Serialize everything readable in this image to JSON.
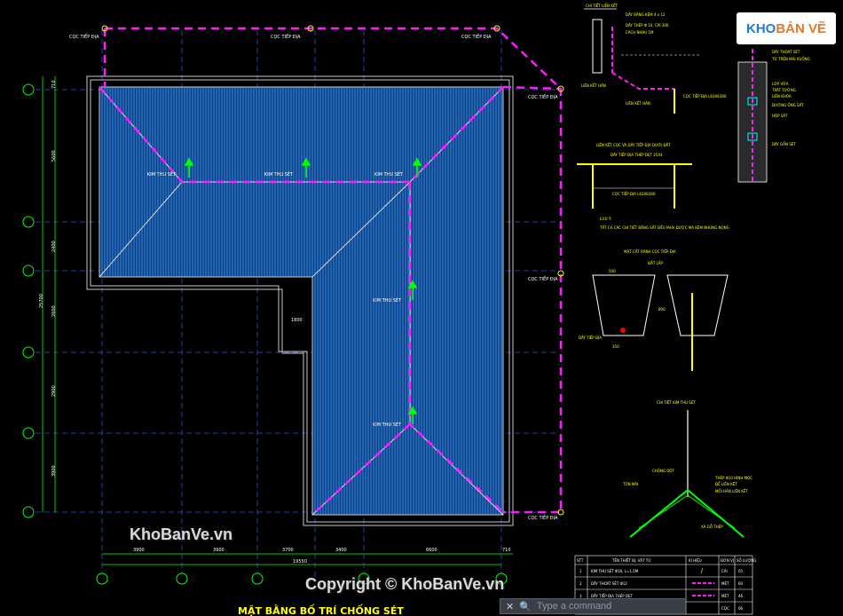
{
  "branding": {
    "logo_text_a": "KHO",
    "logo_text_b": "BẢN VẼ"
  },
  "watermarks": {
    "top": "KhoBanVe.vn",
    "bottom": "Copyright © KhoBanVe.vn"
  },
  "command_bar": {
    "placeholder": "Type a command",
    "close": "✕",
    "search": "🔍"
  },
  "plan": {
    "title": "MẶT BẰNG BỐ TRÍ CHỐNG SÉT",
    "rod_labels": [
      "KIM THU SÉT",
      "KIM THU SÉT",
      "KIM THU SÉT",
      "KIM THU SÉT",
      "KIM THU SÉT"
    ],
    "ground_labels": [
      "CỌC TIẾP ĐỊA",
      "CỌC TIẾP ĐỊA",
      "CỌC TIẾP ĐỊA",
      "CỌC TIẾP ĐỊA",
      "CỌC TIẾP ĐỊA",
      "CỌC TIẾP ĐỊA"
    ],
    "dim_bottom": [
      "3900",
      "3900",
      "3700",
      "3400",
      "6600",
      "710"
    ],
    "dim_total": "19550",
    "dim_left": [
      "710",
      "5600",
      "2400",
      "2600",
      "2900",
      "3900"
    ],
    "dim_left_total": "25700",
    "dim_mid": "1800"
  },
  "details": {
    "d1_title": "CHI TIẾT LIÊN KẾT",
    "d1_notes": [
      "DÂY BĂNG KẼM 4 x 12",
      "DÂY THÉP Φ 10, CÁI 300",
      "CÁCH NHAU 1M",
      "LIÊN KẾT HÀN",
      "LIÊN KẾT HÀN",
      "CỌC TIẾP ĐỊA L63X63X6"
    ],
    "d2_title": "LIÊN KẾT CỌC VÀ DÂY TIẾP ĐỊA DƯỚI ĐẤT",
    "d2_notes": [
      "DÂY TIẾP ĐỊA THÉP DẸT 25X4",
      "CỌC TIẾP ĐỊA L63X63X6"
    ],
    "note_head": "LƯU Ý:",
    "note_body": "TẤT CẢ CÁC CHI TIẾT BẰNG SẮT ĐỀU PHẢI ĐƯỢC MẠ KẼM NHÚNG NÓNG",
    "d3_title": "MẶT CẮT RÃNH CỌC TIẾP ĐỊA",
    "d3_notes": [
      "ĐẤT LẤP",
      "DÂY TIẾP ĐỊA",
      "500",
      "800",
      "350"
    ],
    "d4_notes": [
      "DẦU NỐI",
      "DÂY THOÁT SÉT",
      "TỪ TRÊN MÁI XUỐNG",
      "LỚP VỮA",
      "TRÁT TƯỜNG",
      "LIÊN KHÓA",
      "ĐƯỜNG ỐNG SẮT",
      "HỘP SẮT",
      "DÂY DẪN SÉT"
    ],
    "d5_title": "CHI TIẾT KIM THU SÉT",
    "d5_notes": [
      "CHÔNG DỘT",
      "TÔN MÁI",
      "THÉP Φ10 HÌNH MÓC",
      "ĐỂ LIÊN KẾT",
      "MỐI HÀN LIÊN KẾT",
      "XÀ GỖ THÉP"
    ]
  },
  "legend": {
    "headers": [
      "STT",
      "TÊN THIẾT BỊ, VẬT TƯ",
      "KÍ HIỆU",
      "ĐƠN VỊ",
      "SỐ LƯỢNG"
    ],
    "rows": [
      [
        "1",
        "KIM THU SÉT Φ16, L=1.5M",
        "CÁI",
        "05"
      ],
      [
        "2",
        "DÂY THOÁT SÉT Φ12",
        "MÉT",
        "60"
      ],
      [
        "3",
        "DÂY TIẾP ĐỊA THÉP DẸT",
        "MÉT",
        "46"
      ],
      [
        "4",
        "CỌC TIẾP ĐỊA L63X63X6",
        "CỌC",
        "06"
      ]
    ]
  },
  "colors": {
    "roof": "#0a3f86",
    "roof_line": "#3b8ad9",
    "magenta": "#ff1aff",
    "green": "#00ff00",
    "grid": "#2b4fd8"
  }
}
